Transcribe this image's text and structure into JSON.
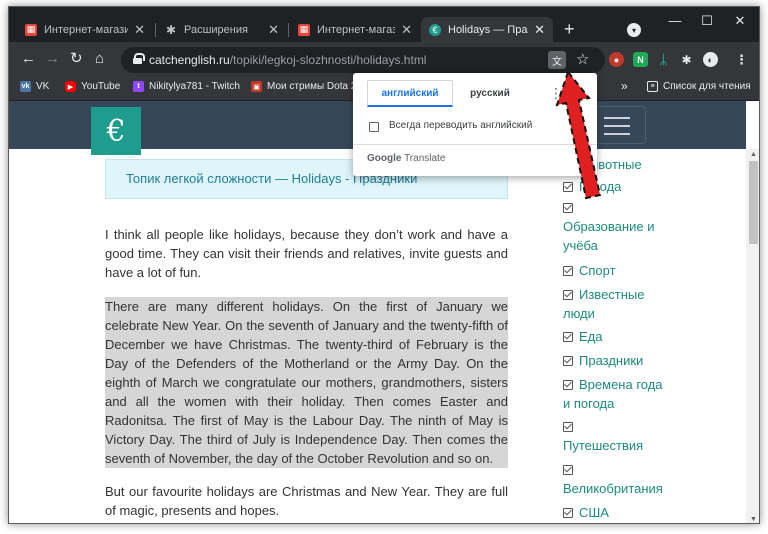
{
  "tabs": [
    {
      "title": "Интернет-магазин",
      "close": "✕",
      "favicon": "store-icon",
      "color": "#e8453c"
    },
    {
      "title": "Расширения",
      "close": "✕",
      "favicon": "puzzle-icon",
      "color": "#bdc1c6"
    },
    {
      "title": "Интернет-магазин",
      "close": "✕",
      "favicon": "store-icon",
      "color": "#e8453c"
    },
    {
      "title": "Holidays — Празд",
      "close": "✕",
      "favicon": "catchenglish-icon",
      "color": "#1e9c8d",
      "active": true
    }
  ],
  "new_tab_label": "+",
  "window_controls": {
    "minimize": "—",
    "maximize": "☐",
    "close": "✕"
  },
  "address_bar": {
    "host": "catchenglish.ru",
    "path": "/topiki/legkoj-slozhnosti/holidays.html"
  },
  "bookmarks": [
    {
      "label": "VK",
      "icon": "vk-icon",
      "color": "#4a76a8"
    },
    {
      "label": "YouTube",
      "icon": "youtube-icon",
      "color": "#ff0000"
    },
    {
      "label": "Nikitylya781 - Twitch",
      "icon": "twitch-icon",
      "color": "#9146ff"
    },
    {
      "label": "Мои стримы Dota 2",
      "icon": "stream-icon",
      "color": "#c0392b"
    }
  ],
  "reading_list_label": "Список для чтения",
  "bookmarks_overflow": "»",
  "translate_popup": {
    "tab_source": "английский",
    "tab_target": "русский",
    "more": "⋮",
    "always_translate": "Всегда переводить английский",
    "brand_google": "Google",
    "brand_translate": "Translate"
  },
  "page": {
    "title_box": "Топик легкой сложности — Holidays - Праздники",
    "paragraphs": [
      "I think all people like holidays, because they don’t work and have a good time. They can visit their friends and relatives, invite guests and have a lot of fun.",
      "There are many different holidays. On the first of January we celebrate New Year. On the seventh of January and the twenty-fifth of December we have Christmas. The twenty-third of February is the Day of the Defenders of the Motherland or the Army Day. On the eighth of March we congratulate our mothers, grandmothers, sisters and all the women with their holiday. Then comes Easter and Radonitsa. The first of May is the Labour Day. The ninth of May is Victory Day. The third of July is Independence Day. Then comes the seventh of November, the day of the October Revolution and so on.",
      "But our favourite holidays are Christmas and New Year. They are full of magic, presents and hopes."
    ],
    "categories": [
      "Животные",
      "Города",
      "Образование и учёба",
      "Спорт",
      "Известные люди",
      "Еда",
      "Праздники",
      "Времена года и погода",
      "Путешествия",
      "Великобритания",
      "США"
    ]
  },
  "colors": {
    "accent": "#1e9c8d",
    "header": "#37475a",
    "arrow": "#e02020"
  }
}
